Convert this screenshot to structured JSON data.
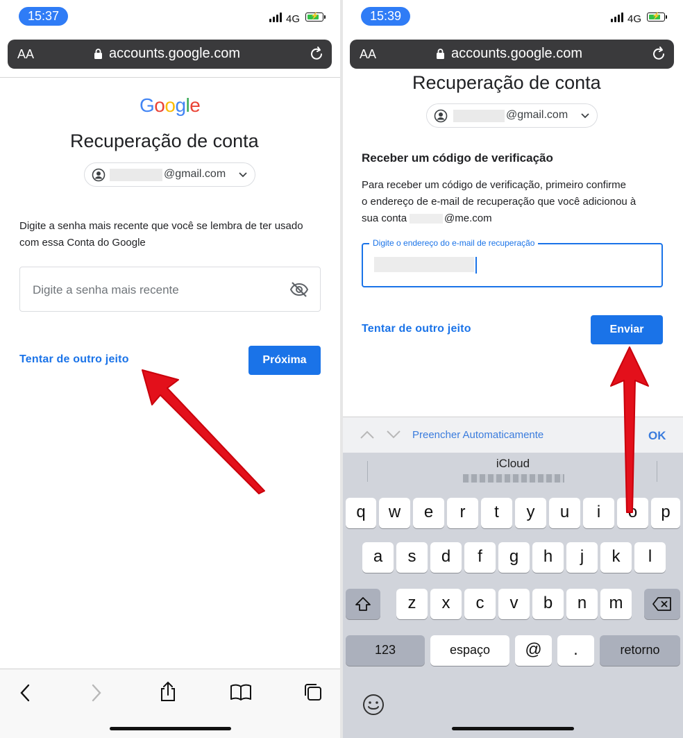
{
  "left": {
    "status": {
      "time": "15:37",
      "network": "4G"
    },
    "browser": {
      "text_size_label": "AA",
      "url": "accounts.google.com"
    },
    "logo_text": "Google",
    "title": "Recuperação de conta",
    "account_email_suffix": "@gmail.com",
    "instruction": "Digite a senha mais recente que você se lembra de ter usado com essa Conta do Google",
    "password_placeholder": "Digite a senha mais recente",
    "try_another_link": "Tentar de outro jeito",
    "next_button": "Próxima"
  },
  "right": {
    "status": {
      "time": "15:39",
      "network": "4G"
    },
    "browser": {
      "text_size_label": "AA",
      "url": "accounts.google.com"
    },
    "title": "Recuperação de conta",
    "account_email_suffix": "@gmail.com",
    "subheading": "Receber um código de verificação",
    "instruction_line1": "Para receber um código de verificação, primeiro confirme",
    "instruction_line2": "o endereço de e-mail de recuperação que você adicionou à",
    "instruction_line3_prefix": "sua conta",
    "instruction_line3_suffix": "@me.com",
    "recovery_email_label": "Digite o endereço do e-mail de recuperação",
    "try_another_link": "Tentar de outro jeito",
    "send_button": "Enviar",
    "autofill": {
      "label": "Preencher Automaticamente",
      "ok": "OK"
    },
    "suggestion": "iCloud",
    "keyboard": {
      "row1": [
        "q",
        "w",
        "e",
        "r",
        "t",
        "y",
        "u",
        "i",
        "o",
        "p"
      ],
      "row2": [
        "a",
        "s",
        "d",
        "f",
        "g",
        "h",
        "j",
        "k",
        "l"
      ],
      "row3": [
        "z",
        "x",
        "c",
        "v",
        "b",
        "n",
        "m"
      ],
      "numbers": "123",
      "space": "espaço",
      "at": "@",
      "dot": ".",
      "return": "retorno"
    }
  },
  "colors": {
    "accent": "#1a73e8",
    "pill": "#2f7cf6",
    "arrow": "#e3101b"
  }
}
